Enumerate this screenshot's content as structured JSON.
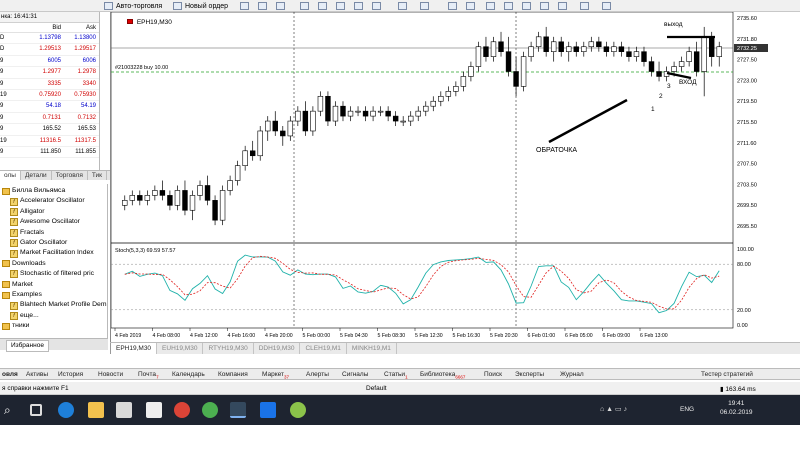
{
  "toolbar": {
    "autotrade": "Авто-торговля",
    "neworder": "Новый ордер"
  },
  "market_watch": {
    "header_time": "нка: 16:41:31",
    "col_bid": "Bid",
    "col_ask": "Ask",
    "rows": [
      {
        "sym": "D",
        "bid": "1.13798",
        "ask": "1.13800",
        "dir": "up"
      },
      {
        "sym": "D",
        "bid": "1.29513",
        "ask": "1.29517",
        "dir": "dn"
      },
      {
        "sym": "9",
        "bid": "6005",
        "ask": "6006",
        "dir": "up"
      },
      {
        "sym": "9",
        "bid": "1.2977",
        "ask": "1.2978",
        "dir": "dn"
      },
      {
        "sym": "9",
        "bid": "3335",
        "ask": "3340",
        "dir": "dn"
      },
      {
        "sym": "19",
        "bid": "0.75920",
        "ask": "0.75930",
        "dir": "dn"
      },
      {
        "sym": "9",
        "bid": "54.18",
        "ask": "54.19",
        "dir": "up"
      },
      {
        "sym": "9",
        "bid": "0.7131",
        "ask": "0.7132",
        "dir": "dn"
      },
      {
        "sym": "9",
        "bid": "165.52",
        "ask": "165.53",
        "dir": "none"
      },
      {
        "sym": "19",
        "bid": "11316.5",
        "ask": "11317.5",
        "dir": "dn"
      },
      {
        "sym": "9",
        "bid": "111.850",
        "ask": "111.855",
        "dir": "none"
      }
    ],
    "tabs": [
      "олы",
      "Детали",
      "Торговля",
      "Тик"
    ]
  },
  "navigator": {
    "items": [
      {
        "label": "Билла Вильямса",
        "kind": "folder"
      },
      {
        "label": "Accelerator Oscillator",
        "kind": "fx"
      },
      {
        "label": "Alligator",
        "kind": "fx"
      },
      {
        "label": "Awesome Oscillator",
        "kind": "fx"
      },
      {
        "label": "Fractals",
        "kind": "fx"
      },
      {
        "label": "Gator Oscillator",
        "kind": "fx"
      },
      {
        "label": "Market Facilitation Index",
        "kind": "fx"
      },
      {
        "label": "Downloads",
        "kind": "folder"
      },
      {
        "label": "Stochastic of filtered pric",
        "kind": "fx"
      },
      {
        "label": "Market",
        "kind": "folder"
      },
      {
        "label": "Examples",
        "kind": "folder"
      },
      {
        "label": "Blahtech Market Profile Dem",
        "kind": "fx"
      },
      {
        "label": "еще...",
        "kind": "fx"
      },
      {
        "label": "тники",
        "kind": "folder"
      }
    ],
    "tab_favorites": "Избранное"
  },
  "chart": {
    "title": "EPH19,M30",
    "order_label": "#21003228 buy 10.00",
    "current_price": "2732.25",
    "price_axis": [
      "2735.60",
      "2731.80",
      "2727.50",
      "2723.00",
      "2719.50",
      "2715.50",
      "2711.60",
      "2707.50",
      "2703.50",
      "2699.50",
      "2695.50"
    ],
    "time_axis": [
      "4 Feb 2019",
      "4 Feb 08:00",
      "4 Feb 12:00",
      "4 Feb 16:00",
      "4 Feb 20:00",
      "5 Feb 00:00",
      "5 Feb 04:30",
      "5 Feb 08:30",
      "5 Feb 12:30",
      "5 Feb 16:30",
      "5 Feb 20:30",
      "6 Feb 01:00",
      "6 Feb 05:00",
      "6 Feb 09:00",
      "6 Feb 13:00"
    ],
    "stoch_label": "Stoch(5,3,3) 69.59 57.57",
    "stoch_axis": [
      "100.00",
      "80.00",
      "20.00",
      "0.00"
    ],
    "annotations": {
      "obratochka": "ОБРАТОЧКА",
      "vyhod": "выход",
      "vhod": "ВХОД",
      "n1": "1",
      "n2": "2",
      "n3": "3"
    },
    "colors": {
      "k_line": "#20b2aa",
      "d_line": "#e0201e",
      "order_line": "#2aa12a"
    }
  },
  "chart_data": {
    "type": "candlestick",
    "title": "EPH19,M30",
    "ylim": [
      2693,
      2738
    ],
    "candles": [
      [
        2700,
        2702,
        2699,
        2701
      ],
      [
        2701,
        2703,
        2700,
        2702
      ],
      [
        2702,
        2703,
        2700,
        2701
      ],
      [
        2701,
        2703,
        2700,
        2702
      ],
      [
        2702,
        2704,
        2701,
        2703
      ],
      [
        2703,
        2705,
        2701,
        2702
      ],
      [
        2702,
        2703,
        2699,
        2700
      ],
      [
        2700,
        2704,
        2699,
        2703
      ],
      [
        2703,
        2705,
        2698,
        2699
      ],
      [
        2699,
        2703,
        2697,
        2702
      ],
      [
        2702,
        2705,
        2701,
        2704
      ],
      [
        2704,
        2706,
        2700,
        2701
      ],
      [
        2701,
        2702,
        2696,
        2697
      ],
      [
        2697,
        2704,
        2696,
        2703
      ],
      [
        2703,
        2706,
        2702,
        2705
      ],
      [
        2705,
        2709,
        2704,
        2708
      ],
      [
        2708,
        2712,
        2707,
        2711
      ],
      [
        2711,
        2713,
        2709,
        2710
      ],
      [
        2710,
        2716,
        2709,
        2715
      ],
      [
        2715,
        2718,
        2713,
        2717
      ],
      [
        2717,
        2719,
        2714,
        2715
      ],
      [
        2715,
        2716,
        2712,
        2714
      ],
      [
        2714,
        2718,
        2713,
        2717
      ],
      [
        2717,
        2720,
        2716,
        2719
      ],
      [
        2719,
        2721,
        2714,
        2715
      ],
      [
        2715,
        2720,
        2714,
        2719
      ],
      [
        2719,
        2723,
        2718,
        2722
      ],
      [
        2722,
        2723,
        2716,
        2717
      ],
      [
        2717,
        2721,
        2716,
        2720
      ],
      [
        2720,
        2721,
        2717,
        2718
      ],
      [
        2718,
        2720,
        2717,
        2719
      ],
      [
        2719,
        2720,
        2718,
        2719
      ],
      [
        2719,
        2720,
        2717,
        2718
      ],
      [
        2718,
        2720,
        2717,
        2719
      ],
      [
        2719,
        2720,
        2718,
        2719
      ],
      [
        2719,
        2720,
        2717,
        2718
      ],
      [
        2718,
        2719,
        2716,
        2717
      ],
      [
        2717,
        2718,
        2716,
        2717
      ],
      [
        2717,
        2719,
        2716,
        2718
      ],
      [
        2718,
        2720,
        2717,
        2719
      ],
      [
        2719,
        2721,
        2718,
        2720
      ],
      [
        2720,
        2722,
        2719,
        2721
      ],
      [
        2721,
        2723,
        2720,
        2722
      ],
      [
        2722,
        2724,
        2721,
        2723
      ],
      [
        2723,
        2725,
        2722,
        2724
      ],
      [
        2724,
        2727,
        2723,
        2726
      ],
      [
        2726,
        2729,
        2725,
        2728
      ],
      [
        2728,
        2733,
        2727,
        2732
      ],
      [
        2732,
        2734,
        2729,
        2730
      ],
      [
        2730,
        2734,
        2729,
        2733
      ],
      [
        2733,
        2735,
        2730,
        2731
      ],
      [
        2731,
        2734,
        2726,
        2727
      ],
      [
        2727,
        2730,
        2722,
        2724
      ],
      [
        2724,
        2731,
        2723,
        2730
      ],
      [
        2730,
        2733,
        2729,
        2732
      ],
      [
        2732,
        2735,
        2731,
        2734
      ],
      [
        2734,
        2736,
        2730,
        2731
      ],
      [
        2731,
        2734,
        2729,
        2733
      ],
      [
        2733,
        2734,
        2730,
        2731
      ],
      [
        2731,
        2733,
        2729,
        2732
      ],
      [
        2732,
        2733,
        2730,
        2731
      ],
      [
        2731,
        2733,
        2730,
        2732
      ],
      [
        2732,
        2734,
        2731,
        2733
      ],
      [
        2733,
        2734,
        2731,
        2732
      ],
      [
        2732,
        2733,
        2730,
        2731
      ],
      [
        2731,
        2733,
        2730,
        2732
      ],
      [
        2732,
        2733,
        2730,
        2731
      ],
      [
        2731,
        2732,
        2729,
        2730
      ],
      [
        2730,
        2732,
        2729,
        2731
      ],
      [
        2731,
        2732,
        2728,
        2729
      ],
      [
        2729,
        2730,
        2726,
        2727
      ],
      [
        2727,
        2729,
        2725,
        2726
      ],
      [
        2726,
        2728,
        2725,
        2727
      ],
      [
        2727,
        2729,
        2726,
        2728
      ],
      [
        2728,
        2730,
        2727,
        2729
      ],
      [
        2729,
        2732,
        2728,
        2731
      ],
      [
        2731,
        2733,
        2726,
        2727
      ],
      [
        2727,
        2736,
        2722,
        2734
      ],
      [
        2734,
        2735,
        2728,
        2730
      ],
      [
        2730,
        2733,
        2728,
        2732
      ]
    ]
  }
}
